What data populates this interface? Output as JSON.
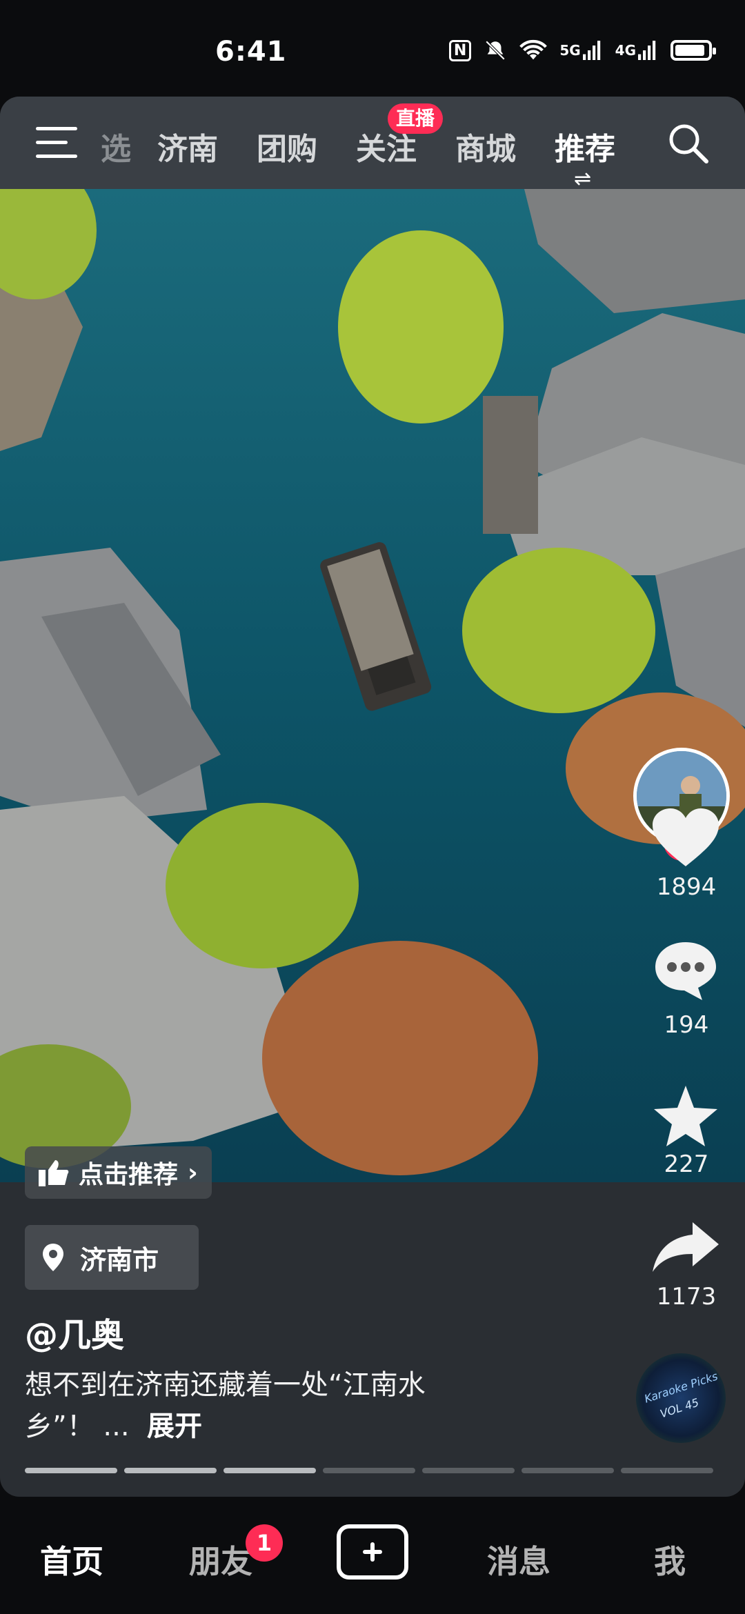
{
  "status_bar": {
    "time": "6:41",
    "nfc": "N",
    "network_5g": "5G",
    "network_4g": "4G"
  },
  "top_nav": {
    "tabs": [
      {
        "label": "选"
      },
      {
        "label": "济南"
      },
      {
        "label": "团购"
      },
      {
        "label": "关注"
      },
      {
        "label": "商城"
      },
      {
        "label": "推荐"
      }
    ],
    "active_tab": "推荐",
    "live_badge": "直播"
  },
  "video": {
    "image_hint": "aerial view of canal with boat and willow trees"
  },
  "right_rail": {
    "likes": "1894",
    "comments": "194",
    "favorites": "227",
    "shares": "1173"
  },
  "recommend_chip": {
    "label": "点击推荐"
  },
  "location_chip": {
    "label": "济南市"
  },
  "post": {
    "author": "@几奥",
    "caption_line1": "想不到在济南还藏着一处“江南水",
    "caption_line2": "乡”！ ...",
    "expand": "展开"
  },
  "progress": {
    "segments_done": 3,
    "segments_total": 7
  },
  "music_disc": {
    "text_line1": "Karaoke Picks",
    "text_line2": "VOL 45"
  },
  "bottom_nav": {
    "items": [
      {
        "label": "首页"
      },
      {
        "label": "朋友"
      },
      {
        "label": "消息"
      },
      {
        "label": "我"
      }
    ],
    "friends_badge": "1"
  },
  "colors": {
    "accent": "#fe2c55",
    "water": "#0d5467",
    "willow": "#a8c43a"
  }
}
